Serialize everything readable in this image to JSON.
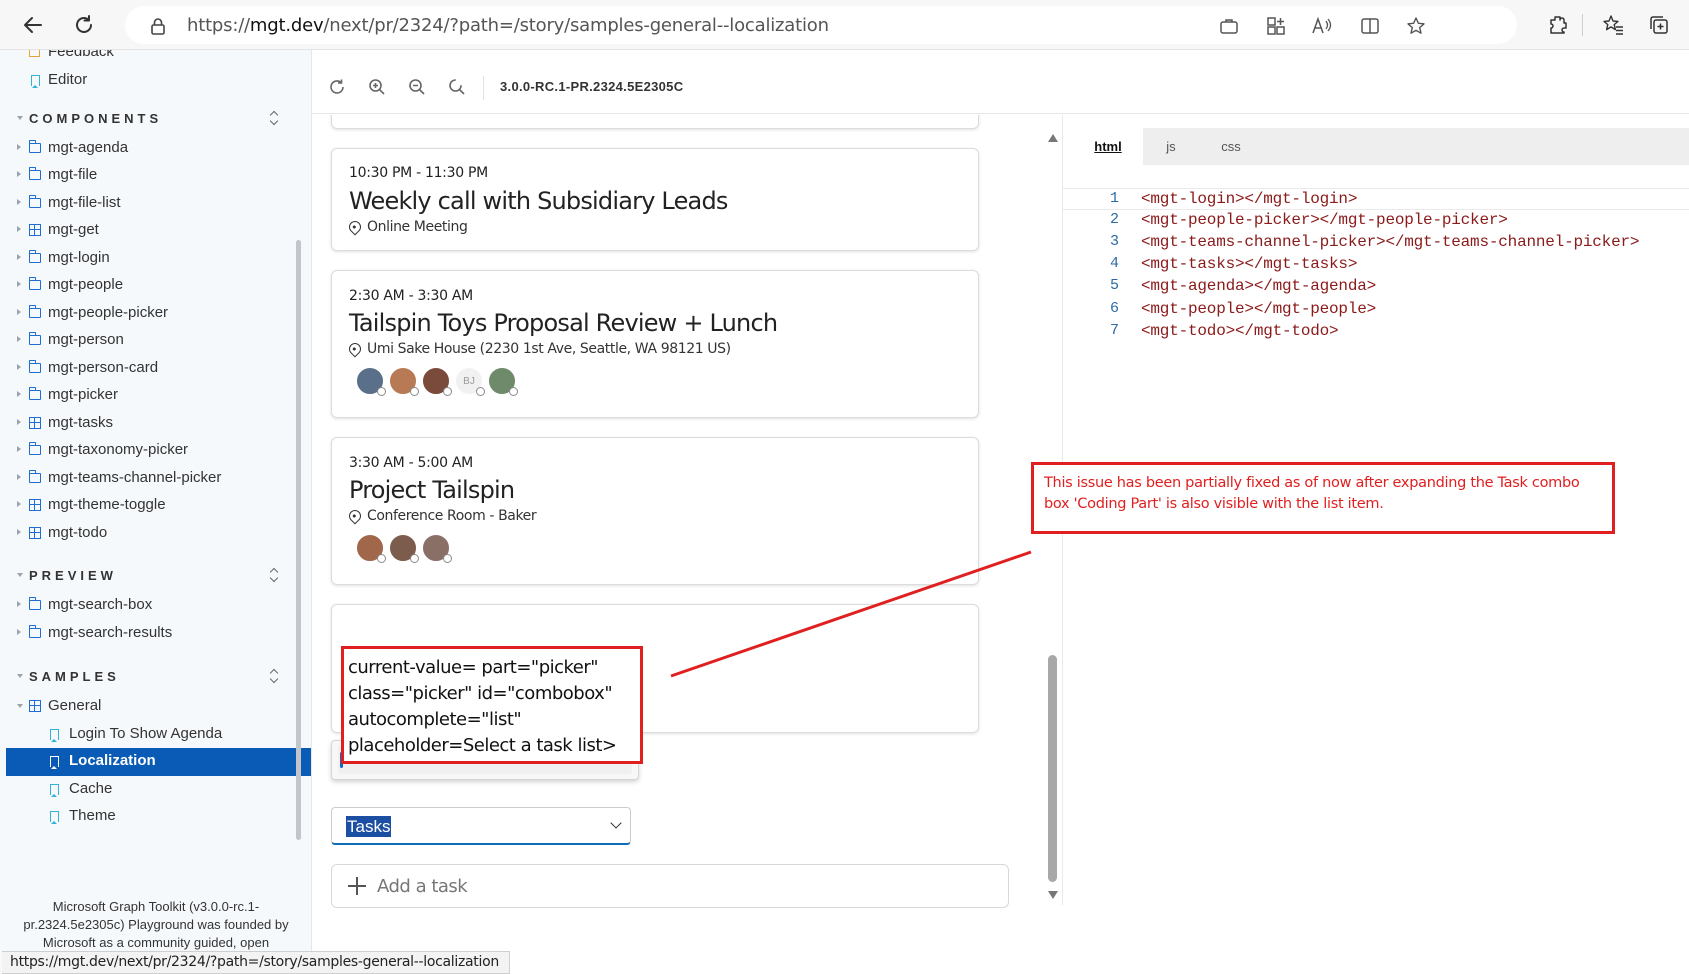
{
  "browser": {
    "url_prefix": "https://",
    "url_host": "mgt.dev",
    "url_path": "/next/pr/2324/?path=/story/samples-general--localization",
    "status_url": "https://mgt.dev/next/pr/2324/?path=/story/samples-general--localization"
  },
  "sidebar": {
    "top_items": [
      {
        "label": "Feedback",
        "icon": "feedback-icon"
      },
      {
        "label": "Editor",
        "icon": "bookmark-icon"
      }
    ],
    "components_heading": "COMPONENTS",
    "components": [
      {
        "label": "mgt-agenda",
        "icon": "folder-icon"
      },
      {
        "label": "mgt-file",
        "icon": "folder-icon"
      },
      {
        "label": "mgt-file-list",
        "icon": "folder-icon"
      },
      {
        "label": "mgt-get",
        "icon": "component-icon"
      },
      {
        "label": "mgt-login",
        "icon": "folder-icon"
      },
      {
        "label": "mgt-people",
        "icon": "folder-icon"
      },
      {
        "label": "mgt-people-picker",
        "icon": "folder-icon"
      },
      {
        "label": "mgt-person",
        "icon": "folder-icon"
      },
      {
        "label": "mgt-person-card",
        "icon": "folder-icon"
      },
      {
        "label": "mgt-picker",
        "icon": "folder-icon"
      },
      {
        "label": "mgt-tasks",
        "icon": "component-icon"
      },
      {
        "label": "mgt-taxonomy-picker",
        "icon": "folder-icon"
      },
      {
        "label": "mgt-teams-channel-picker",
        "icon": "folder-icon"
      },
      {
        "label": "mgt-theme-toggle",
        "icon": "component-icon"
      },
      {
        "label": "mgt-todo",
        "icon": "component-icon"
      }
    ],
    "preview_heading": "PREVIEW",
    "preview": [
      {
        "label": "mgt-search-box",
        "icon": "folder-icon"
      },
      {
        "label": "mgt-search-results",
        "icon": "folder-icon"
      }
    ],
    "samples_heading": "SAMPLES",
    "samples_group": {
      "label": "General",
      "icon": "component-icon"
    },
    "samples": [
      {
        "label": "Login To Show Agenda",
        "selected": false
      },
      {
        "label": "Localization",
        "selected": true
      },
      {
        "label": "Cache",
        "selected": false
      },
      {
        "label": "Theme",
        "selected": false
      }
    ],
    "footer": "Microsoft Graph Toolkit (v3.0.0-rc.1-pr.2324.5e2305c) Playground was founded by Microsoft as a community guided, open"
  },
  "toolbar": {
    "version": "3.0.0-RC.1-PR.2324.5E2305C",
    "icons": [
      "refresh-icon",
      "zoom-in-icon",
      "zoom-out-icon",
      "zoom-reset-icon"
    ]
  },
  "agenda": {
    "events": [
      {
        "time": "10:30 PM - 11:30 PM",
        "title": "Weekly call with Subsidiary Leads",
        "location": "Online Meeting",
        "attendees": []
      },
      {
        "time": "2:30 AM - 3:30 AM",
        "title": "Tailspin Toys Proposal Review + Lunch",
        "location": "Umi Sake House (2230 1st Ave, Seattle, WA 98121 US)",
        "attendees": [
          "#5a6f8a",
          "#b87a55",
          "#7a4a3a",
          "BJ",
          "#6f8a6a"
        ]
      },
      {
        "time": "3:30 AM - 5:00 AM",
        "title": "Project Tailspin",
        "location": "Conference Room - Baker",
        "attendees": [
          "#a0674a",
          "#7c5c4c",
          "#8a6f66"
        ]
      }
    ]
  },
  "tasks": {
    "dropdown_option": "Tasks",
    "combo_value": "Tasks",
    "add_task": "Add a task"
  },
  "editor": {
    "tabs": [
      {
        "label": "html",
        "active": true
      },
      {
        "label": "js",
        "active": false
      },
      {
        "label": "css",
        "active": false
      }
    ],
    "lines": [
      {
        "num": "1",
        "code": "<mgt-login></mgt-login>"
      },
      {
        "num": "2",
        "code": "<mgt-people-picker></mgt-people-picker>"
      },
      {
        "num": "3",
        "code": "<mgt-teams-channel-picker></mgt-teams-channel-picker>"
      },
      {
        "num": "4",
        "code": "<mgt-tasks></mgt-tasks>"
      },
      {
        "num": "5",
        "code": "<mgt-agenda></mgt-agenda>"
      },
      {
        "num": "6",
        "code": "<mgt-people></mgt-people>"
      },
      {
        "num": "7",
        "code": "<mgt-todo></mgt-todo>"
      }
    ]
  },
  "annotations": {
    "note": "This issue has been partially fixed as of now after expanding the Task combo box 'Coding Part' is also visible with the list item.",
    "code_lines": [
      "current-value= part=\"picker\"",
      "class=\"picker\" id=\"combobox\"",
      "autocomplete=\"list\"",
      "placeholder=Select a task list>"
    ],
    "color": "#e02020"
  },
  "colors": {
    "accent": "#0f6cbd",
    "selected_bg": "#0a5bb5",
    "code_tag": "#8b1a1a"
  }
}
